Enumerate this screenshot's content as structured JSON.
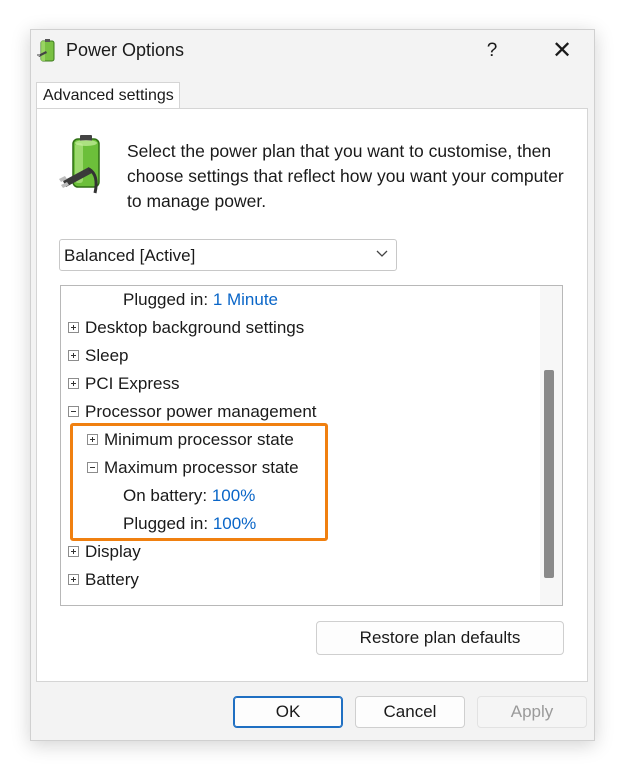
{
  "window": {
    "title": "Power Options",
    "help": "?",
    "close": "✕"
  },
  "tab": {
    "label": "Advanced settings"
  },
  "description": "Select the power plan that you want to customise, then choose settings that reflect how you want your computer to manage power.",
  "plan_select": {
    "value": "Balanced [Active]"
  },
  "tree": {
    "rows": [
      {
        "label": "Plugged in:",
        "value": "1 Minute"
      },
      {
        "label": "Desktop background settings"
      },
      {
        "label": "Sleep"
      },
      {
        "label": "PCI Express"
      },
      {
        "label": "Processor power management"
      },
      {
        "label": "Minimum processor state"
      },
      {
        "label": "Maximum processor state"
      },
      {
        "label": "On battery:",
        "value": "100%"
      },
      {
        "label": "Plugged in:",
        "value": "100%"
      },
      {
        "label": "Display"
      },
      {
        "label": "Battery"
      }
    ]
  },
  "buttons": {
    "restore": "Restore plan defaults",
    "ok": "OK",
    "cancel": "Cancel",
    "apply": "Apply"
  },
  "colors": {
    "accent_link": "#0a66c8",
    "highlight": "#f08010",
    "ok_border": "#1f6fc2"
  },
  "icons": {
    "app": "power-options-battery-icon",
    "header": "battery-plug-icon",
    "dropdown": "chevron-down-icon"
  }
}
